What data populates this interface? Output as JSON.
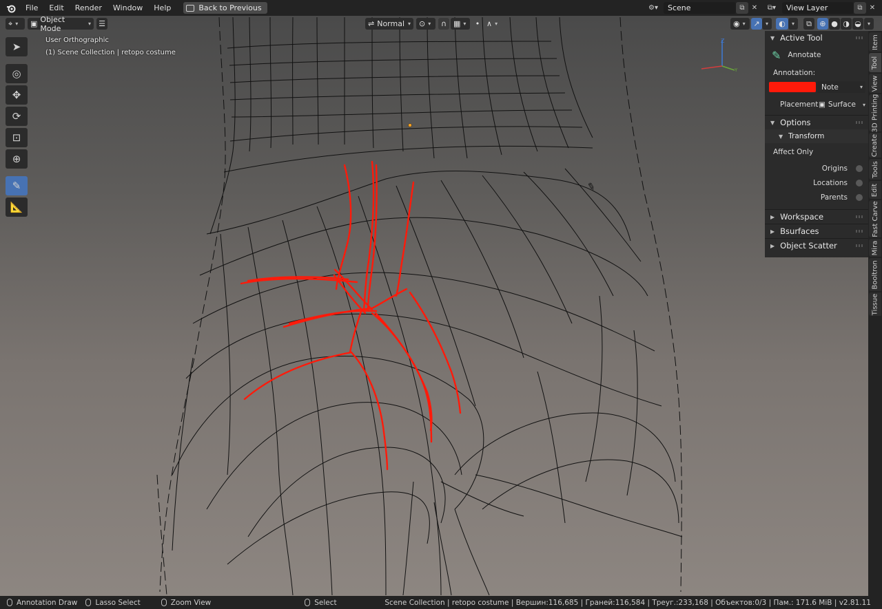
{
  "topbar": {
    "menus": [
      "File",
      "Edit",
      "Render",
      "Window",
      "Help"
    ],
    "back_button": "Back to Previous",
    "scene_field": "Scene",
    "view_layer_field": "View Layer"
  },
  "viewport_header": {
    "mode": "Object Mode",
    "orientation": "Normal"
  },
  "viewport": {
    "view_name": "User Orthographic",
    "collection_info": "(1) Scene Collection | retopo costume",
    "annotation_color": "#ff1a0a"
  },
  "toolbar": {
    "tools": [
      {
        "name": "select-box-tool",
        "icon": "cursor-icon",
        "glyph": "➤"
      },
      {
        "name": "cursor-tool",
        "icon": "crosshair-icon",
        "glyph": "◎"
      },
      {
        "name": "move-tool",
        "icon": "move-icon",
        "glyph": "✥"
      },
      {
        "name": "rotate-tool",
        "icon": "rotate-icon",
        "glyph": "⟳"
      },
      {
        "name": "scale-tool",
        "icon": "scale-icon",
        "glyph": "⊡"
      },
      {
        "name": "transform-tool",
        "icon": "transform-icon",
        "glyph": "⊕"
      },
      {
        "name": "annotate-tool",
        "icon": "annotate-icon",
        "glyph": "✎"
      },
      {
        "name": "measure-tool",
        "icon": "ruler-icon",
        "glyph": "📐"
      }
    ]
  },
  "npanel": {
    "active_tool": {
      "title": "Active Tool",
      "tool_name": "Annotate",
      "annotation_label": "Annotation:",
      "annotation_layer": "Note",
      "annotation_color": "#ff1a0a",
      "placement_label": "Placement",
      "placement_value": "Surface"
    },
    "options": {
      "title": "Options",
      "transform_title": "Transform",
      "affect_only_label": "Affect Only",
      "rows": [
        "Origins",
        "Locations",
        "Parents"
      ]
    },
    "collapsed_panels": [
      "Workspace",
      "Bsurfaces",
      "Object Scatter"
    ]
  },
  "tabs": [
    "Item",
    "Tool",
    "View",
    "3D Printing",
    "Create",
    "Tools",
    "Edit",
    "Fast Carve",
    "Mira",
    "Booltron",
    "Tissue"
  ],
  "statusbar": {
    "left_items": [
      "Annotation Draw",
      "Lasso Select",
      "Zoom View",
      "Select"
    ],
    "right_info": "Scene Collection | retopo costume | Вершин:116,685 | Граней:116,584 | Треуг.:233,168 | Объектов:0/3 | Пам.: 171.6 MiB | v2.81.11"
  }
}
